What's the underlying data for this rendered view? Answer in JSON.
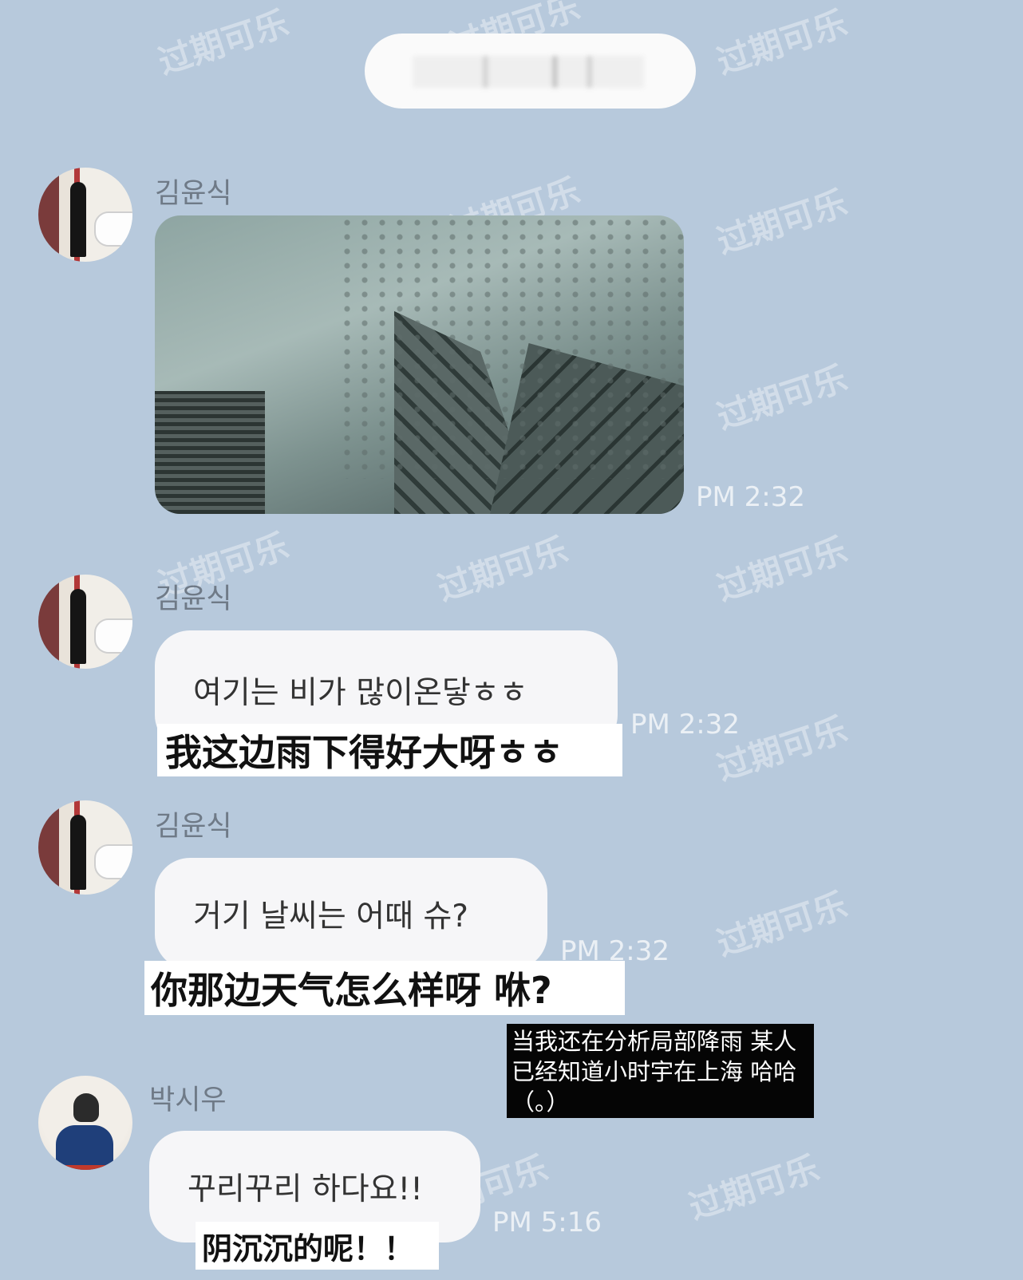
{
  "watermark_text": "过期可乐",
  "date_separator": {
    "label": ""
  },
  "messages": [
    {
      "sender": "김윤식",
      "type": "image",
      "image_desc_icon": "rainy-window-photo",
      "time": "PM 2:32"
    },
    {
      "sender": "김윤식",
      "type": "text",
      "text": "여기는 비가 많이온닿ㅎㅎ",
      "translation": "我这边雨下得好大呀ㅎㅎ",
      "time": "PM 2:32"
    },
    {
      "sender": "김윤식",
      "type": "text",
      "text": "거기 날씨는 어때 슈?",
      "translation": "你那边天气怎么样呀 咻?",
      "time": "PM 2:32"
    },
    {
      "sender": "박시우",
      "type": "text",
      "text": "꾸리꾸리 하다요!!",
      "translation": "阴沉沉的呢！！",
      "time": "PM 5:16"
    }
  ],
  "note": "当我还在分析局部降雨 某人\n已经知道小时宇在上海 哈哈\n（。）"
}
